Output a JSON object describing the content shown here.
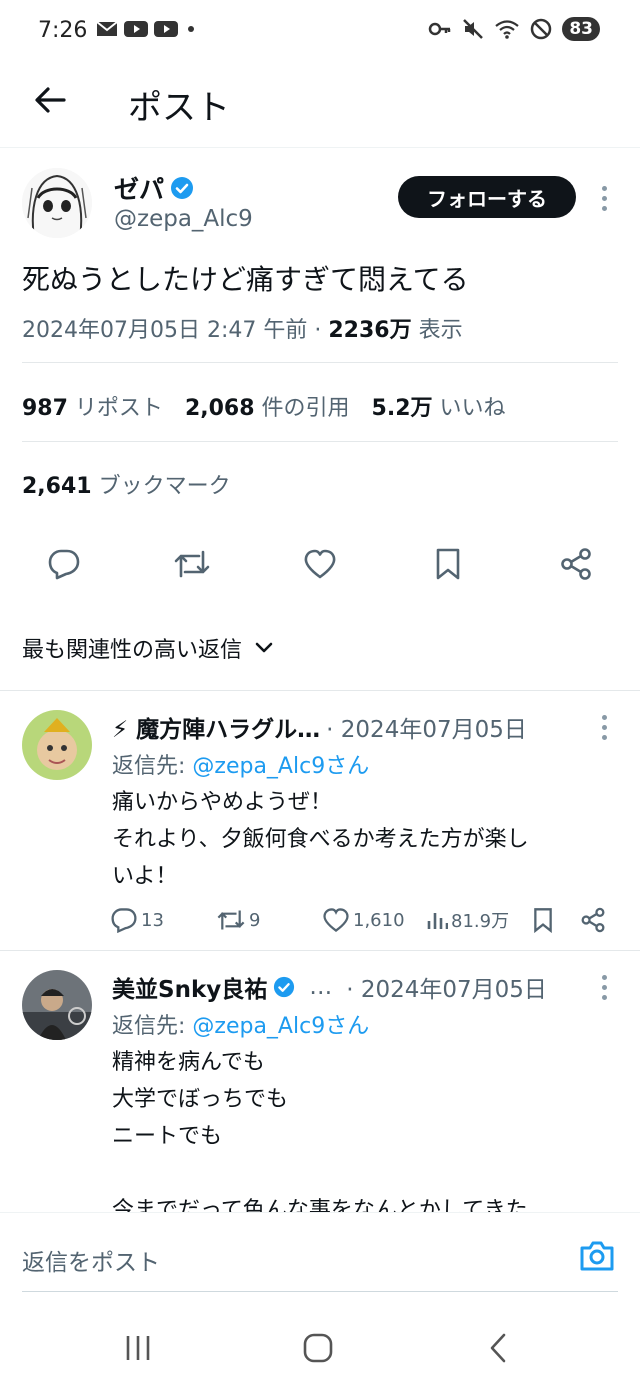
{
  "status_bar": {
    "time": "7:26",
    "battery": "83",
    "left_icons": [
      "mail-icon",
      "youtube-icon",
      "youtube-icon",
      "dot-icon"
    ],
    "right_icons": [
      "key-icon",
      "mute-icon",
      "wifi-icon",
      "dnd-icon"
    ]
  },
  "header": {
    "title": "ポスト"
  },
  "post": {
    "author_name": "ゼパ",
    "handle": "@zepa_Alc9",
    "follow_label": "フォローする",
    "text": "死ぬうとしたけど痛すぎて悶えてる",
    "date": "2024年07月05日 2:47 午前 · ",
    "views_count": "2236万",
    "views_label": " 表示",
    "reposts_count": "987",
    "reposts_label": " リポスト",
    "quotes_count": "2,068",
    "quotes_label": " 件の引用",
    "likes_count": "5.2万",
    "likes_label": " いいね",
    "bookmarks_count": "2,641",
    "bookmarks_label": " ブックマーク"
  },
  "sort": {
    "label": "最も関連性の高い返信"
  },
  "replies": [
    {
      "name": "⚡ 魔方陣ハラグル…",
      "date": "· 2024年07月05日",
      "reply_to_prefix": "返信先: ",
      "reply_to_handle": "@zepa_Alc9さん",
      "lines": [
        "痛いからやめようぜ！",
        "それより、夕飯何食べるか考えた方が楽し",
        "いよ！"
      ],
      "replies": "13",
      "reposts": "9",
      "likes": "1,610",
      "views": "81.9万"
    },
    {
      "name": "美並Snky良祐",
      "ellipsis": "…",
      "date": "· 2024年07月05日",
      "reply_to_prefix": "返信先: ",
      "reply_to_handle": "@zepa_Alc9さん",
      "lines": [
        "精神を病んでも",
        "大学でぼっちでも",
        "ニートでも",
        "",
        "今までだって色んな事をなんとかしてきた"
      ]
    }
  ],
  "compose": {
    "placeholder": "返信をポスト"
  },
  "colors": {
    "accent": "#1d9bf0",
    "text": "#0f1419",
    "secondary": "#536471"
  }
}
